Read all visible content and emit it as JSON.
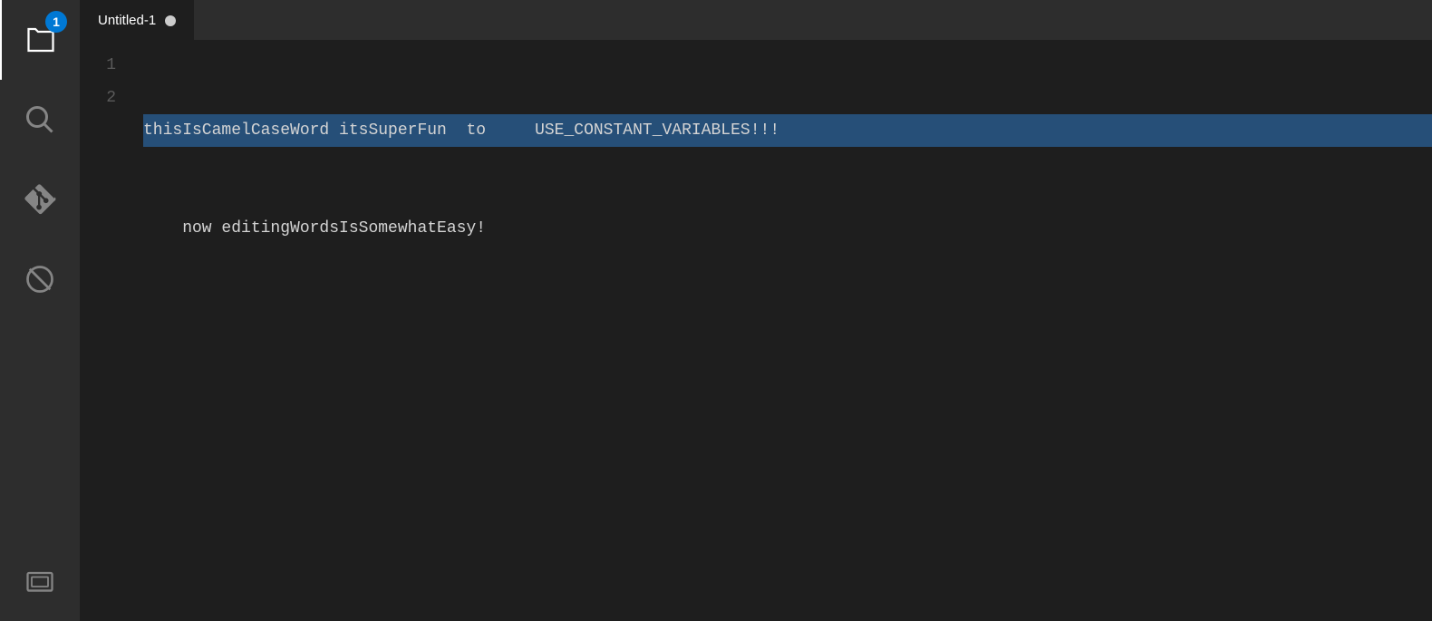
{
  "tab": {
    "title": "Untitled-1",
    "modified": true
  },
  "editor": {
    "lines": [
      {
        "number": "1",
        "content": "thisIsCamelCaseWord itsSuperFun  to     USE_CONSTANT_VARIABLES!!!",
        "selected": true
      },
      {
        "number": "2",
        "content": "    now editingWordsIsSomewhatEasy!",
        "selected": false
      }
    ]
  },
  "activityBar": {
    "items": [
      {
        "name": "explorer",
        "label": "Explorer",
        "active": true,
        "badge": "1"
      },
      {
        "name": "search",
        "label": "Search",
        "active": false,
        "badge": null
      },
      {
        "name": "git",
        "label": "Source Control",
        "active": false,
        "badge": null
      },
      {
        "name": "extensions",
        "label": "Extensions",
        "active": false,
        "badge": null
      },
      {
        "name": "remote",
        "label": "Remote Explorer",
        "active": false,
        "badge": null
      }
    ]
  },
  "colors": {
    "bg": "#1e1e1e",
    "activityBg": "#2d2d2d",
    "tabActiveBg": "#1e1e1e",
    "tabInactiveBg": "#2d2d2d",
    "selectedLine": "#264f78",
    "badgeBg": "#0078d4",
    "lineNumber": "#5a5a5a",
    "text": "#d4d4d4"
  }
}
